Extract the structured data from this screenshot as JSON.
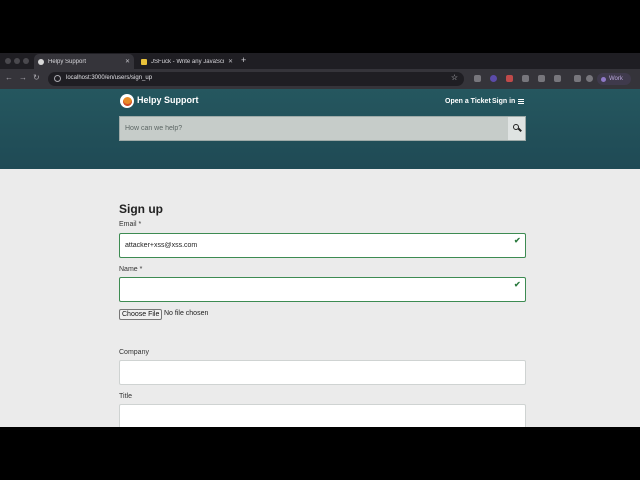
{
  "browser": {
    "tabs": [
      {
        "title": "Helpy Support",
        "active": true,
        "favicon_color": "#d8d8d8"
      },
      {
        "title": "JSFuck - Write any JavaScript",
        "active": false,
        "favicon_color": "#e8c13a"
      }
    ],
    "new_tab": "+",
    "url": "localhost:3000/en/users/sign_up",
    "profile_label": "Work"
  },
  "header": {
    "brand": "Helpy Support",
    "open_ticket": "Open a Ticket",
    "sign_in": "Sign in",
    "search_placeholder": "How can we help?"
  },
  "form": {
    "title": "Sign up",
    "email_label": "Email *",
    "email_value": "attacker+xss@xss.com",
    "name_label": "Name *",
    "name_value": "",
    "file_button": "Choose File",
    "file_status": "No file chosen",
    "company_label": "Company",
    "company_value": "",
    "title_label": "Title",
    "title_value": ""
  },
  "colors": {
    "header_bg": "#25575f",
    "page_bg": "#ebebeb",
    "valid_border": "#3d8b52",
    "logo_heart": "#ea8b27"
  }
}
